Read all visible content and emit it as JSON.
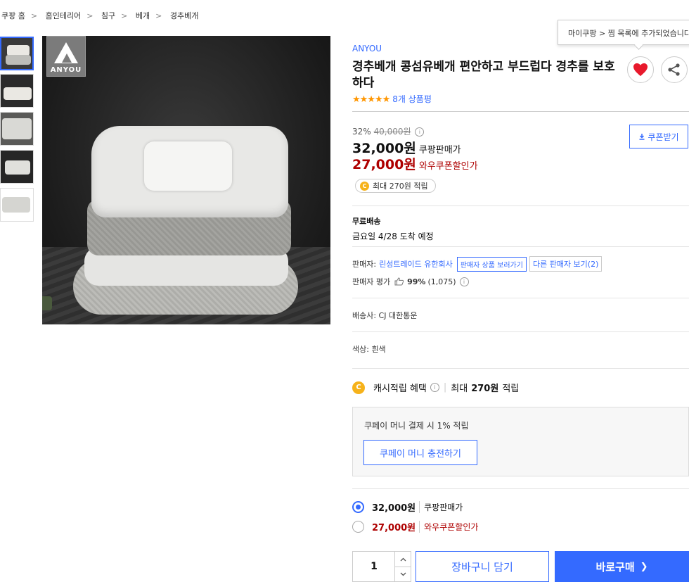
{
  "breadcrumb": [
    "쿠팡 홈",
    "홈인테리어",
    "침구",
    "베개",
    "경추베개"
  ],
  "tooltip": "마이쿠팡 > 찜 목록에 추가되었습니다",
  "product": {
    "logo_text": "ANYOU",
    "brand": "ANYOU",
    "title": "경추베개 콩섬유베개 편안하고 부드럽다 경추를 보호하다",
    "rating_stars": "★★★★★",
    "review_count": "8개 상품평"
  },
  "icons": {
    "wishlist": "heart-icon",
    "share": "share-icon",
    "download": "download-icon",
    "coin": "coin-icon",
    "info": "info-icon",
    "thumb_up": "thumb-up-icon",
    "chevron": "chevron-right-icon"
  },
  "price": {
    "discount_rate": "32%",
    "original_price": "40,000원",
    "sale_price": "32,000원",
    "sale_label": "쿠팡판매가",
    "coupon_price": "27,000원",
    "coupon_label": "와우쿠폰할인가",
    "coupon_button": "쿠폰받기",
    "cash_chip": "최대 270원 적립"
  },
  "shipping": {
    "title": "무료배송",
    "date": "금요일 4/28 도착 예정"
  },
  "seller": {
    "label": "판매자:",
    "name": "린성트레이드 유한회사",
    "view_products_button": "판매자 상품 보러가기",
    "other_sellers_button": "다른 판매자 보기(2)",
    "eval_label": "판매자 평가",
    "eval_percent": "99%",
    "eval_count": "(1,075)"
  },
  "courier": "배송사: CJ 대한통운",
  "color_option": "색상: 흰색",
  "cash_benefit": {
    "label": "캐시적립 혜택",
    "max": "최대",
    "amount": "270원",
    "suffix": "적립"
  },
  "coupay": {
    "text": "쿠페이 머니 결제 시 1% 적립",
    "button": "쿠페이 머니 충전하기"
  },
  "price_options": [
    {
      "price": "32,000원",
      "label": "쿠팡판매가",
      "selected": true
    },
    {
      "price": "27,000원",
      "label": "와우쿠폰할인가",
      "selected": false
    }
  ],
  "purchase": {
    "quantity": "1",
    "cart_button": "장바구니 담기",
    "buy_button": "바로구매",
    "buy_arrow": "❯"
  },
  "colors": {
    "accent": "#346aff",
    "price_red": "#ae0000",
    "star": "#ff9600",
    "coin": "#f6b21a"
  }
}
